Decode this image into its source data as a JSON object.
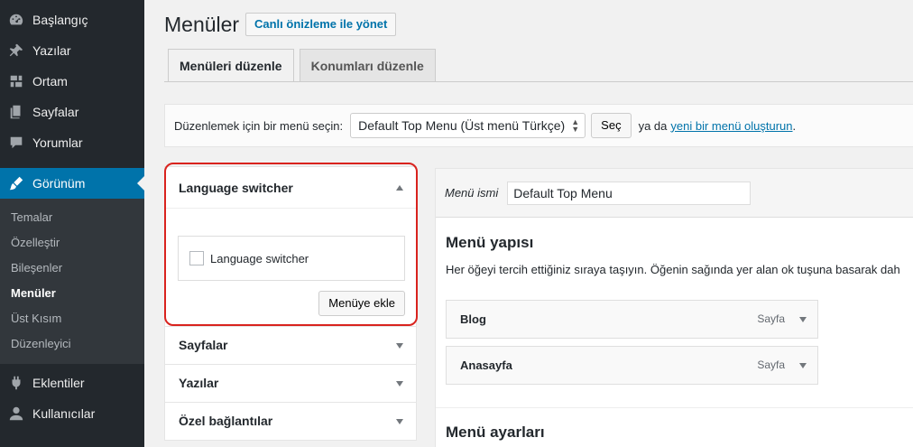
{
  "sidebar": {
    "items_top": [
      {
        "label": "Başlangıç",
        "icon": "dashboard-icon"
      },
      {
        "label": "Yazılar",
        "icon": "pin-icon"
      },
      {
        "label": "Ortam",
        "icon": "media-icon"
      },
      {
        "label": "Sayfalar",
        "icon": "pages-icon"
      },
      {
        "label": "Yorumlar",
        "icon": "comments-icon"
      }
    ],
    "active": {
      "label": "Görünüm",
      "icon": "brush-icon"
    },
    "submenu": [
      "Temalar",
      "Özelleştir",
      "Bileşenler",
      "Menüler",
      "Üst Kısım",
      "Düzenleyici"
    ],
    "submenu_current": "Menüler",
    "items_bottom": [
      {
        "label": "Eklentiler",
        "icon": "plugins-icon"
      },
      {
        "label": "Kullanıcılar",
        "icon": "users-icon"
      }
    ]
  },
  "header": {
    "title": "Menüler",
    "live_button": "Canlı önizleme ile yönet"
  },
  "tabs": [
    {
      "label": "Menüleri düzenle",
      "active": true
    },
    {
      "label": "Konumları düzenle",
      "active": false
    }
  ],
  "select_bar": {
    "label": "Düzenlemek için bir menü seçin:",
    "selected": "Default Top Menu (Üst menü Türkçe)",
    "select_button": "Seç",
    "or_text": "ya da",
    "create_link": "yeni bir menü oluşturun",
    "period": "."
  },
  "left": {
    "open_panel": {
      "title": "Language switcher",
      "checkbox_label": "Language switcher",
      "add_button": "Menüye ekle"
    },
    "panels": [
      "Sayfalar",
      "Yazılar",
      "Özel bağlantılar"
    ]
  },
  "right": {
    "name_label": "Menü ismi",
    "name_value": "Default Top Menu",
    "structure_title": "Menü yapısı",
    "structure_desc": "Her öğeyi tercih ettiğiniz sıraya taşıyın. Öğenin sağında yer alan ok tuşuna basarak dah",
    "items": [
      {
        "label": "Blog",
        "type": "Sayfa"
      },
      {
        "label": "Anasayfa",
        "type": "Sayfa"
      }
    ],
    "settings_title": "Menü ayarları"
  },
  "colors": {
    "sidebar_bg": "#23282d",
    "accent": "#0073aa",
    "highlight": "#d9231e"
  }
}
